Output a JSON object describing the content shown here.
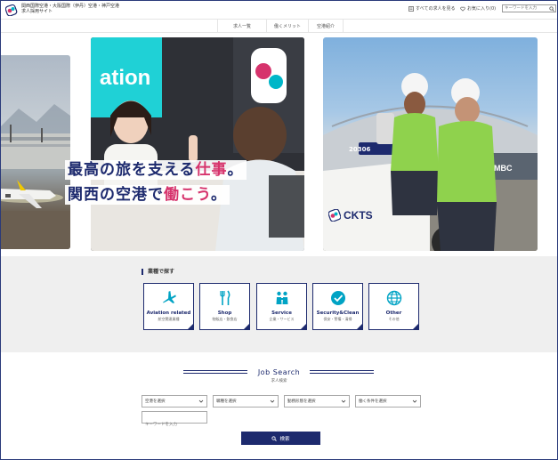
{
  "header": {
    "brand_line1": "関西国際空港・大阪国際（伊丹）空港・神戸空港",
    "brand_line2": "求人採用サイト",
    "link_all_jobs": "すべての求人を見る",
    "link_favorites": "お気に入り(0)",
    "search_placeholder": "キーワードを入力"
  },
  "nav": {
    "items": [
      {
        "label": "求人一覧"
      },
      {
        "label": "働くメリット"
      },
      {
        "label": "空港紹介"
      }
    ]
  },
  "hero": {
    "catch_line1_part1": "最高の旅を支える",
    "catch_line1_part2": "仕事",
    "catch_line1_part3": "。",
    "catch_line2_part1": "関西の空港で",
    "catch_line2_part2": "働こう",
    "catch_line2_part3": "。",
    "sign_text": "ation",
    "vehicle_number": "20306",
    "vehicle_brand": "CKTS",
    "building_text": "MBC"
  },
  "categories": {
    "title": "業種で探す",
    "items": [
      {
        "en": "Aviation related",
        "jp": "航空関連業種"
      },
      {
        "en": "Shop",
        "jp": "物販店・飲食店"
      },
      {
        "en": "Service",
        "jp": "企業・サービス"
      },
      {
        "en": "Security&Clean",
        "jp": "保安・警備・清掃"
      },
      {
        "en": "Other",
        "jp": "その他"
      }
    ]
  },
  "job_search": {
    "title": "Job Search",
    "subtitle": "求人検索",
    "selects": [
      {
        "label": "空港を選択"
      },
      {
        "label": "職種を選択"
      },
      {
        "label": "勤務形態を選択"
      },
      {
        "label": "働く条件を選択"
      }
    ],
    "keyword_placeholder": "キーワードを入力",
    "search_button": "検索"
  },
  "colors": {
    "navy": "#1d2a6e",
    "pink": "#d6336c",
    "teal": "#00b6c8"
  }
}
